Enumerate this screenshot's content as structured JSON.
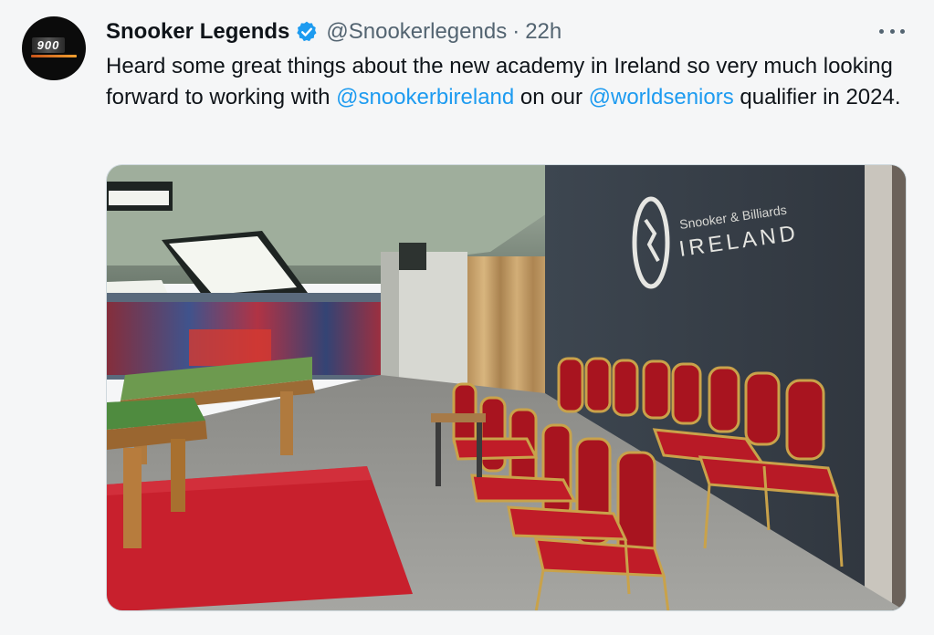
{
  "tweet": {
    "display_name": "Snooker Legends",
    "handle": "@Snookerlegends",
    "separator": "·",
    "time": "22h",
    "avatar_text": "900",
    "text_part1": "Heard some great things about the new academy in Ireland so very much looking forward to working with ",
    "mention1": "@snookerbireland",
    "text_part2": " on our ",
    "mention2": "@worldseniors",
    "text_part3": " qualifier in 2024.",
    "image": {
      "sign_line1": "Snooker & Billiards",
      "sign_line2": "IRELAND"
    }
  },
  "icons": {
    "verified": "verified-badge-icon",
    "more": "more-options-icon"
  },
  "colors": {
    "link": "#1d9bf0",
    "verified": "#1d9bf0",
    "secondary_text": "#536471",
    "background": "#f5f6f7"
  }
}
